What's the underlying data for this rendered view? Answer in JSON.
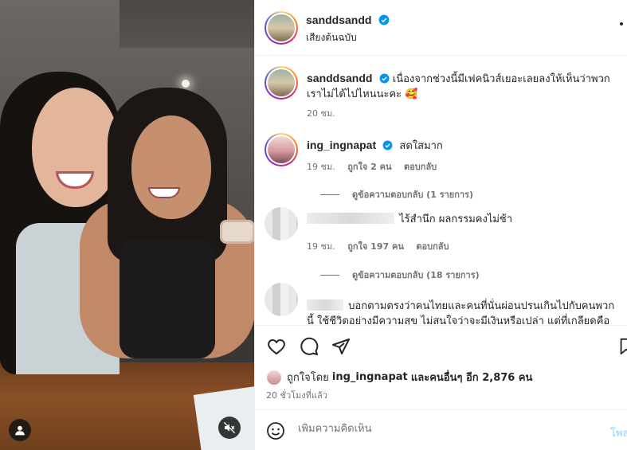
{
  "header": {
    "username": "sanddsandd",
    "subtitle": "เสียงต้นฉบับ"
  },
  "caption": {
    "username": "sanddsandd",
    "text": "เนื่องจากช่วงนี้มีเฟคนิวส์เยอะเลยลงให้เห็นว่าพวกเราไม่ได้ไปไหนนะคะ 🥰",
    "time": "20 ชม."
  },
  "comments": [
    {
      "username": "ing_ingnapat",
      "text": "สดใสมาก",
      "time": "19 ชม.",
      "likes": "ถูกใจ 2 คน",
      "reply": "ตอบกลับ",
      "view_replies": "ดูข้อความตอบกลับ (1 รายการ)"
    },
    {
      "username": "",
      "text": "ไร้สำนึก ผลกรรมคงไม่ช้า",
      "time": "19 ชม.",
      "likes": "ถูกใจ 197 คน",
      "reply": "ตอบกลับ",
      "view_replies": "ดูข้อความตอบกลับ (18 รายการ)"
    },
    {
      "username": "",
      "text": "บอกตามตรงว่าคนไทยและคนที่นั่นผ่อนปรนเกินไปกับคนพวกนี้ ใช้ชีวิตอย่างมีความสุข ไม่สนใจว่าจะมีเงินหรือเปล่า แต่ที่เกลียดคือ"
    }
  ],
  "liked_by": {
    "prefix": "ถูกใจโดย",
    "user": "ing_ingnapat",
    "suffix": "และคนอื่นๆ อีก 2,876 คน"
  },
  "time_ago": "20 ชั่วโมงที่แล้ว",
  "composer": {
    "placeholder": "เพิ่มความคิดเห็น",
    "post_label": "โพสต์"
  },
  "icons": {
    "verified_color": "#0095f6",
    "like": "heart-icon",
    "comment": "comment-icon",
    "share": "paper-plane-icon",
    "save": "bookmark-icon",
    "emoji": "smiley-icon",
    "mute": "muted-speaker-icon",
    "user": "user-icon"
  }
}
